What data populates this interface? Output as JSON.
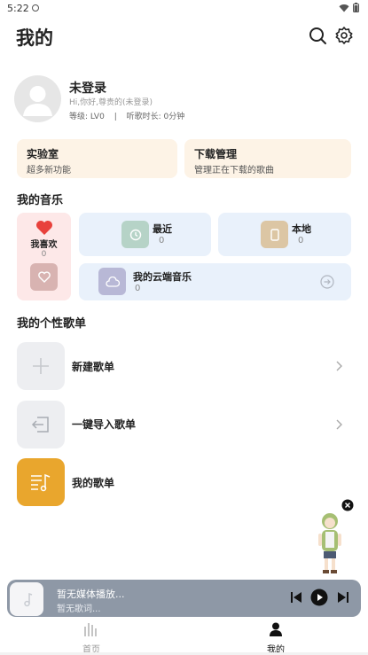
{
  "status_bar": {
    "time": "5:22"
  },
  "header": {
    "title": "我的"
  },
  "profile": {
    "name": "未登录",
    "greeting": "Hi,你好,尊贵的(未登录)",
    "level": "等级: LV0",
    "separator": "|",
    "listen_time": "听歌时长: 0分钟"
  },
  "feature_cards": [
    {
      "title": "实验室",
      "subtitle": "超多新功能"
    },
    {
      "title": "下载管理",
      "subtitle": "管理正在下载的歌曲"
    }
  ],
  "my_music": {
    "title": "我的音乐",
    "favorite": {
      "label": "我喜欢",
      "count": "0"
    },
    "recent": {
      "label": "最近",
      "count": "0"
    },
    "local": {
      "label": "本地",
      "count": "0"
    },
    "cloud": {
      "label": "我的云端音乐",
      "count": "0"
    }
  },
  "playlists": {
    "title": "我的个性歌单",
    "items": [
      {
        "label": "新建歌单"
      },
      {
        "label": "一键导入歌单"
      },
      {
        "label": "我的歌单"
      }
    ]
  },
  "player": {
    "title": "暂无媒体播放...",
    "subtitle": "暂无歌词..."
  },
  "bottom_nav": [
    {
      "label": "首页",
      "active": false
    },
    {
      "label": "我的",
      "active": true
    }
  ],
  "colors": {
    "accent_red": "#e8413c",
    "feature_card_bg": "#fdf3e6",
    "favorite_bg": "#fde8e8",
    "tile_bg": "#e9f1fb",
    "playlist_orange": "#e9a62d",
    "player_bg": "#8e98a6"
  }
}
